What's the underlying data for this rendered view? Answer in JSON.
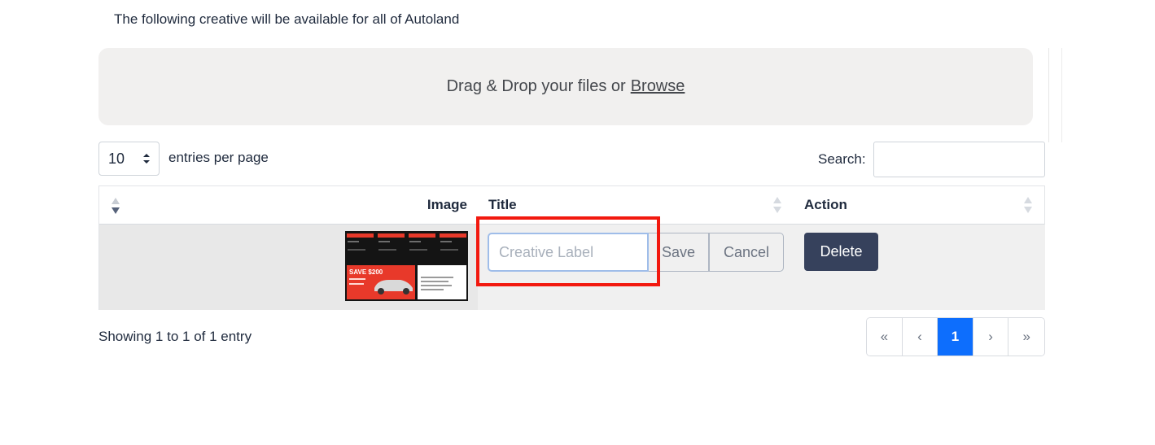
{
  "intro_text": "The following creative will be available for all of Autoland",
  "dropzone": {
    "prefix": "Drag & Drop your files or",
    "browse_label": "Browse"
  },
  "per_page": {
    "value": "10",
    "label": "entries per page"
  },
  "search": {
    "label": "Search:",
    "value": ""
  },
  "table": {
    "columns": [
      "Image",
      "Title",
      "Action"
    ],
    "row": {
      "title_placeholder": "Creative Label",
      "save_label": "Save",
      "cancel_label": "Cancel",
      "delete_label": "Delete"
    }
  },
  "thumbnail": {
    "promo_text": "SAVE $200"
  },
  "footer": {
    "showing": "Showing 1 to 1 of 1 entry"
  },
  "pagination": {
    "first": "«",
    "prev": "‹",
    "current": "1",
    "next": "›",
    "last": "»"
  },
  "colors": {
    "accent": "#0d6efd",
    "delete_button": "#36415c",
    "highlight": "#f2190f"
  }
}
